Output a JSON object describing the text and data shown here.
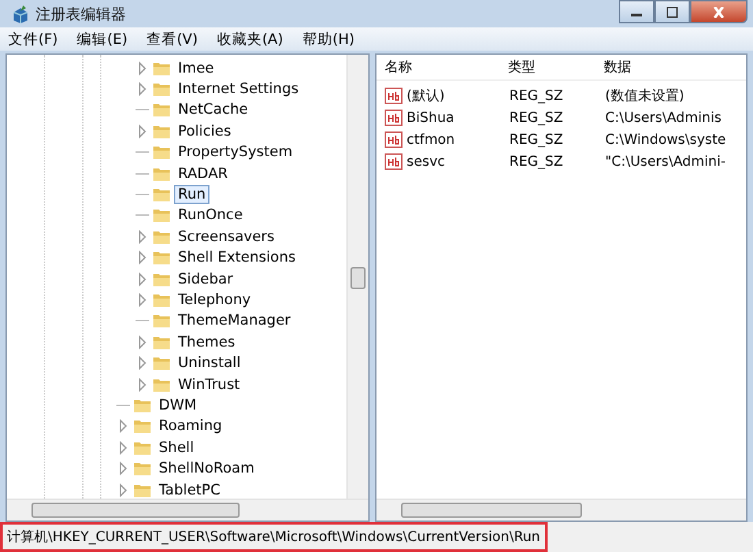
{
  "window": {
    "title": "注册表编辑器"
  },
  "menu": [
    "文件(F)",
    "编辑(E)",
    "查看(V)",
    "收藏夹(A)",
    "帮助(H)"
  ],
  "tree": {
    "inner_items": [
      {
        "label": "Imee",
        "expandable": true,
        "selected": false
      },
      {
        "label": "Internet Settings",
        "expandable": true,
        "selected": false
      },
      {
        "label": "NetCache",
        "expandable": false,
        "selected": false
      },
      {
        "label": "Policies",
        "expandable": true,
        "selected": false
      },
      {
        "label": "PropertySystem",
        "expandable": false,
        "selected": false
      },
      {
        "label": "RADAR",
        "expandable": false,
        "selected": false
      },
      {
        "label": "Run",
        "expandable": false,
        "selected": true
      },
      {
        "label": "RunOnce",
        "expandable": false,
        "selected": false
      },
      {
        "label": "Screensavers",
        "expandable": true,
        "selected": false
      },
      {
        "label": "Shell Extensions",
        "expandable": true,
        "selected": false
      },
      {
        "label": "Sidebar",
        "expandable": true,
        "selected": false
      },
      {
        "label": "Telephony",
        "expandable": true,
        "selected": false
      },
      {
        "label": "ThemeManager",
        "expandable": false,
        "selected": false
      },
      {
        "label": "Themes",
        "expandable": true,
        "selected": false
      },
      {
        "label": "Uninstall",
        "expandable": true,
        "selected": false
      },
      {
        "label": "WinTrust",
        "expandable": true,
        "selected": false
      }
    ],
    "outer_items": [
      {
        "label": "DWM",
        "expandable": false,
        "selected": false
      },
      {
        "label": "Roaming",
        "expandable": true,
        "selected": false
      },
      {
        "label": "Shell",
        "expandable": true,
        "selected": false
      },
      {
        "label": "ShellNoRoam",
        "expandable": true,
        "selected": false
      },
      {
        "label": "TabletPC",
        "expandable": true,
        "selected": false
      }
    ]
  },
  "values": {
    "columns": [
      "名称",
      "类型",
      "数据"
    ],
    "rows": [
      [
        "(默认)",
        "REG_SZ",
        "(数值未设置)"
      ],
      [
        "BiShua",
        "REG_SZ",
        "C:\\Users\\Adminis"
      ],
      [
        "ctfmon",
        "REG_SZ",
        "C:\\Windows\\syste"
      ],
      [
        "sesvc",
        "REG_SZ",
        "\"C:\\Users\\Admini-"
      ]
    ]
  },
  "status_bar": {
    "path": "计算机\\HKEY_CURRENT_USER\\Software\\Microsoft\\Windows\\CurrentVersion\\Run",
    "highlighted": true
  }
}
